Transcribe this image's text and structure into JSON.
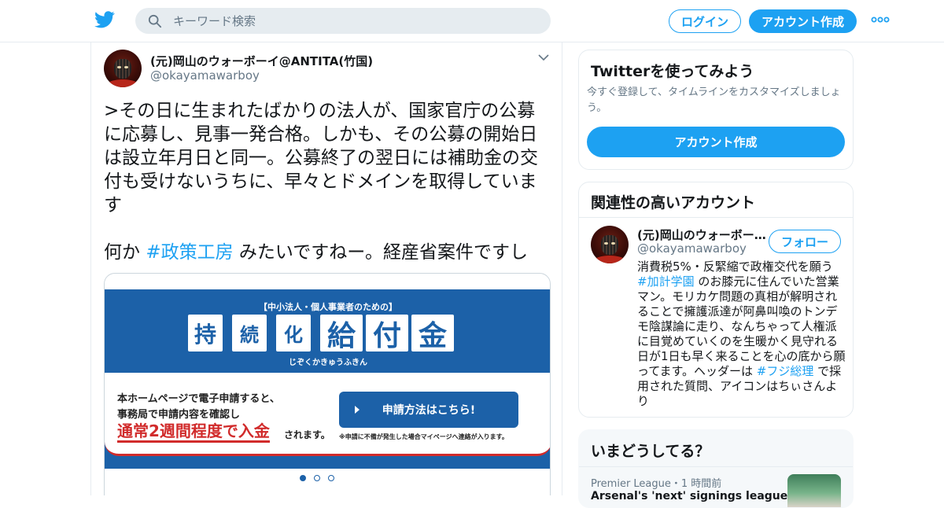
{
  "header": {
    "logo_icon": "twitter-bird-icon",
    "search_placeholder": "キーワード検索",
    "login_label": "ログイン",
    "signup_label": "アカウント作成",
    "more_icon": "more-dots-icon",
    "accent_color": "#1da1f2"
  },
  "tweet": {
    "author_name": "(元)岡山のウォーボーイ@ANTITA(竹国)",
    "author_handle": "@okayamawarboy",
    "text_main": ">その日に生まれたばかりの法人が、国家官庁の公募に応募し、見事一発合格。しかも、その公募の開始日は設立年月日と同一。公募終了の翌日には補助金の交付も受けないうちに、早々とドメインを取得しています",
    "text_pre": "何か ",
    "hashtag": "#政策工房",
    "text_post": " みたいですねー。経産省案件ですし",
    "card": {
      "subtitle": "【中小法人・個人事業者のための】",
      "title_chars": [
        "持",
        "続",
        "化",
        "給",
        "付",
        "金"
      ],
      "ruby": "じぞくかきゅうふきん",
      "line1": "本ホームページで電子申請すると、",
      "line2": "事務局で申請内容を確認し",
      "highlight": "通常2週間程度で入金",
      "suffix": "されます。",
      "apply_label": "申請方法はこちら!",
      "note": "※申請に不備が発生した場合マイページへ連絡が入ります。",
      "slides_total": 3,
      "slide_active": 1,
      "brand_blue": "#1c61a8",
      "alert_red": "#d12b2b"
    }
  },
  "sidebar": {
    "signup_box": {
      "title": "Twitterを使ってみよう",
      "desc": "今すぐ登録して、タイムラインをカスタマイズしましょう。",
      "button_label": "アカウント作成"
    },
    "related": {
      "title": "関連性の高いアカウント",
      "name": "(元)岡山のウォーボーイ@ANTITA(竹国)",
      "handle": "@okayamawarboy",
      "follow_label": "フォロー",
      "bio_1": "消費税5%・反緊縮で政権交代を願う ",
      "bio_tag1": "#加計学園",
      "bio_2": " のお膝元に住んでいた営業マン。モリカケ問題の真相が解明されることで擁護派達が阿鼻叫喚のトンデモ陰謀論に走り、なんちゃって人権派に目覚めていくのを生暖かく見守れる日が1日も早く来ることを心の底から願ってます。ヘッダーは ",
      "bio_tag2": "#フジ総理",
      "bio_3": " で採用された質問、アイコンはちぃさんより"
    },
    "trends": {
      "title": "いまどうしてる？",
      "meta": "Premier League・1 時間前",
      "headline": "Arsenal's 'next' signings league"
    }
  }
}
